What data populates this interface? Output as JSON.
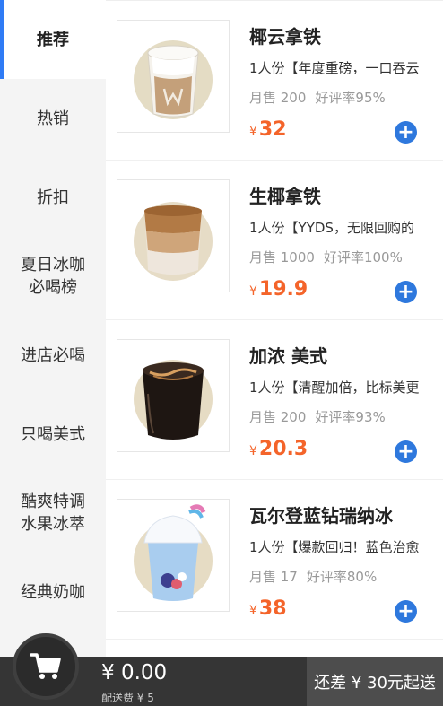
{
  "sidebar": {
    "items": [
      {
        "label": "推荐"
      },
      {
        "label": "热销"
      },
      {
        "label": "折扣"
      },
      {
        "label": "夏日冰咖\n必喝榜"
      },
      {
        "label": "进店必喝"
      },
      {
        "label": "只喝美式"
      },
      {
        "label": "酷爽特调\n水果冰萃"
      },
      {
        "label": "经典奶咖"
      }
    ]
  },
  "products": [
    {
      "name": "椰云拿铁",
      "desc": "1人份【年度重磅，一口吞云",
      "monthly": "月售 200",
      "rating": "好评率95%",
      "currency": "¥",
      "price": "32",
      "image_icon": "coconut-latte-cup"
    },
    {
      "name": "生椰拿铁",
      "desc": "1人份【YYDS，无限回购的",
      "monthly": "月售 1000",
      "rating": "好评率100%",
      "currency": "¥",
      "price": "19.9",
      "image_icon": "coconut-latte-glass"
    },
    {
      "name": "加浓 美式",
      "desc": "1人份【清醒加倍，比标美更",
      "monthly": "月售 200",
      "rating": "好评率93%",
      "currency": "¥",
      "price": "20.3",
      "image_icon": "americano-glass"
    },
    {
      "name": "瓦尔登蓝钻瑞纳冰",
      "desc": "1人份【爆款回归！蓝色治愈",
      "monthly": "月售 17",
      "rating": "好评率80%",
      "currency": "¥",
      "price": "38",
      "image_icon": "blue-frappe-cup"
    }
  ],
  "cart": {
    "total": "¥ 0.00",
    "delivery_fee": "配送费 ¥ 5",
    "min_order": "还差 ¥ 30元起送"
  },
  "colors": {
    "accent": "#2f7bf5",
    "price": "#f4642a",
    "add_button": "#2e78dd",
    "bottom_bar": "#353535"
  }
}
